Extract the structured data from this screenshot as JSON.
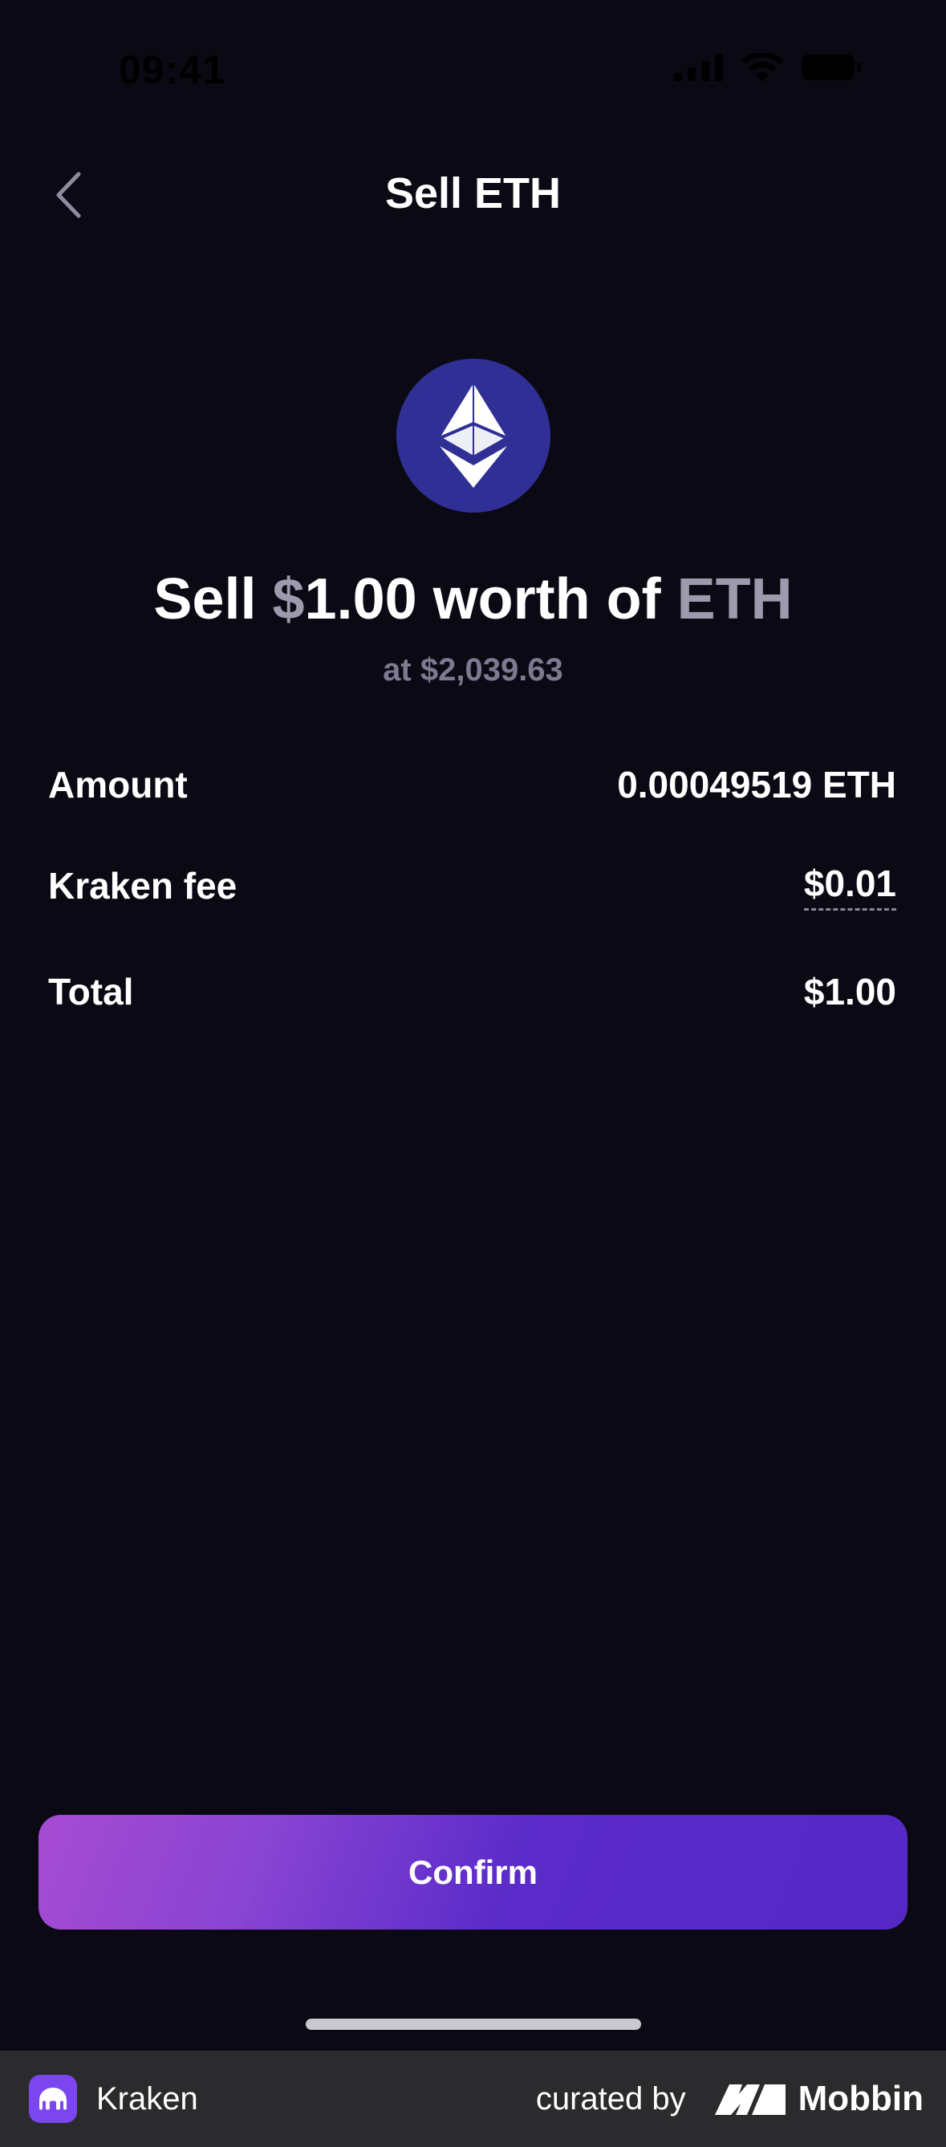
{
  "status_bar": {
    "time": "09:41"
  },
  "nav": {
    "title": "Sell ETH"
  },
  "headline": {
    "sell_word": "Sell",
    "currency_symbol": "$",
    "amount": "1.00",
    "worth_of": "worth of",
    "asset": "ETH"
  },
  "rate": "at $2,039.63",
  "details": {
    "amount": {
      "label": "Amount",
      "value": "0.00049519 ETH"
    },
    "fee": {
      "label": "Kraken fee",
      "value": "$0.01"
    },
    "total": {
      "label": "Total",
      "value": "$1.00"
    }
  },
  "confirm_label": "Confirm",
  "footer": {
    "app_name": "Kraken",
    "curated_by": "curated by",
    "brand": "Mobbin"
  },
  "colors": {
    "background": "#0b0a14",
    "eth_circle": "#2f2f95",
    "muted_text": "#9e9aae",
    "button_start": "#a64bd2",
    "button_end": "#5528c6"
  }
}
